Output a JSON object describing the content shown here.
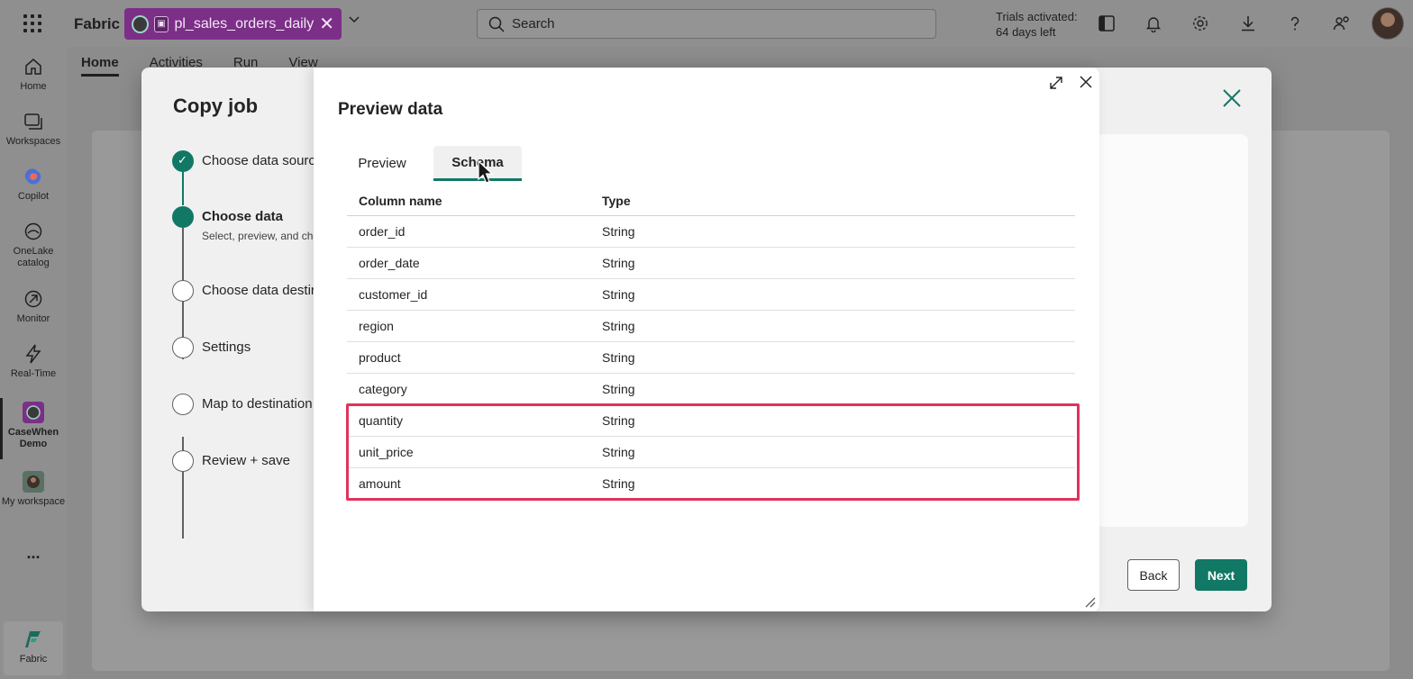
{
  "topbar": {
    "brand": "Fabric",
    "item_name": "pl_sales_orders_daily",
    "search_placeholder": "Search",
    "trial_line1": "Trials activated:",
    "trial_line2": "64 days left"
  },
  "rail": {
    "items": [
      {
        "label": "Home",
        "icon": "home-icon"
      },
      {
        "label": "Workspaces",
        "icon": "workspaces-icon"
      },
      {
        "label": "Copilot",
        "icon": "copilot-icon"
      },
      {
        "label": "OneLake catalog",
        "icon": "onelake-icon"
      },
      {
        "label": "Monitor",
        "icon": "monitor-icon"
      },
      {
        "label": "Real-Time",
        "icon": "lightning-icon"
      },
      {
        "label": "CaseWhen Demo",
        "icon": "workspace-logo-icon"
      },
      {
        "label": "My workspace",
        "icon": "avatar-icon"
      },
      {
        "label": "...",
        "icon": "more-icon"
      },
      {
        "label": "Fabric",
        "icon": "fabric-icon"
      }
    ]
  },
  "ribbon": {
    "tabs": [
      "Home",
      "Activities",
      "Run",
      "View"
    ]
  },
  "wizard": {
    "title": "Copy job",
    "back_label": "Back",
    "next_label": "Next",
    "steps": [
      {
        "label": "Choose data source",
        "state": "done"
      },
      {
        "label": "Choose data",
        "state": "current",
        "sub": "Select, preview, and choose data"
      },
      {
        "label": "Choose data destination",
        "state": "todo"
      },
      {
        "label": "Settings",
        "state": "todo"
      },
      {
        "label": "Map to destination",
        "state": "todo"
      },
      {
        "label": "Review + save",
        "state": "todo"
      }
    ]
  },
  "preview": {
    "title": "Preview data",
    "tabs": [
      "Preview",
      "Schema"
    ],
    "active_tab": "Schema",
    "columns": [
      "Column name",
      "Type"
    ],
    "rows": [
      {
        "name": "order_id",
        "type": "String"
      },
      {
        "name": "order_date",
        "type": "String"
      },
      {
        "name": "customer_id",
        "type": "String"
      },
      {
        "name": "region",
        "type": "String"
      },
      {
        "name": "product",
        "type": "String"
      },
      {
        "name": "category",
        "type": "String"
      },
      {
        "name": "quantity",
        "type": "String"
      },
      {
        "name": "unit_price",
        "type": "String"
      },
      {
        "name": "amount",
        "type": "String"
      }
    ]
  },
  "colors": {
    "accent": "#117865",
    "highlight": "#e0325c",
    "item_pill": "#7b2f87"
  }
}
